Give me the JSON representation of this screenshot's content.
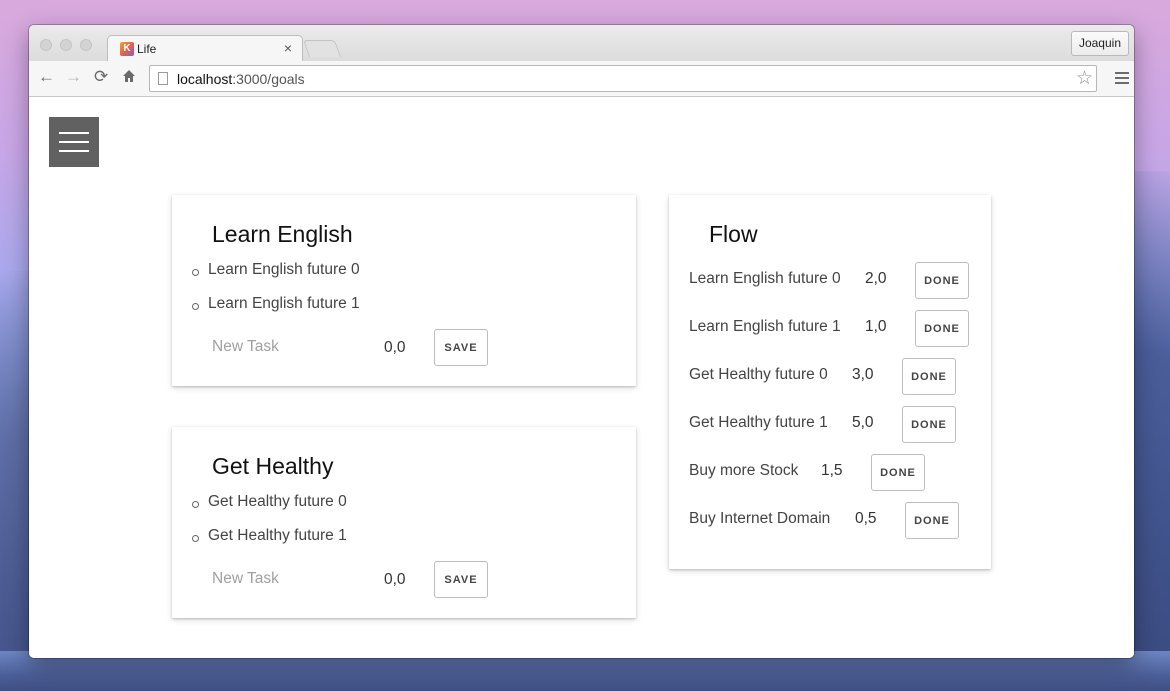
{
  "browser": {
    "tab_title": "Life",
    "tab_favicon_letter": "K",
    "tab_close": "×",
    "user_button": "Joaquin",
    "url_host": "localhost",
    "url_path": ":3000/goals",
    "back_icon": "arrow-left",
    "forward_icon": "arrow-right",
    "reload_icon": "reload",
    "home_icon": "home",
    "bookmark_icon": "star",
    "menu_icon": "hamburger"
  },
  "goals": [
    {
      "title": "Learn English",
      "tasks": [
        "Learn English future 0",
        "Learn English future 1"
      ],
      "new_task_placeholder": "New Task",
      "new_task_value": "0,0",
      "save_label": "SAVE"
    },
    {
      "title": "Get Healthy",
      "tasks": [
        "Get Healthy future 0",
        "Get Healthy future 1"
      ],
      "new_task_placeholder": "New Task",
      "new_task_value": "0,0",
      "save_label": "SAVE"
    }
  ],
  "flow": {
    "title": "Flow",
    "done_label": "DONE",
    "items": [
      {
        "name": "Learn English future 0",
        "value": "2,0"
      },
      {
        "name": "Learn English future 1",
        "value": "1,0"
      },
      {
        "name": "Get Healthy future 0",
        "value": "3,0"
      },
      {
        "name": "Get Healthy future 1",
        "value": "5,0"
      },
      {
        "name": "Buy more Stock",
        "value": "1,5"
      },
      {
        "name": "Buy Internet Domain",
        "value": "0,5"
      }
    ]
  }
}
